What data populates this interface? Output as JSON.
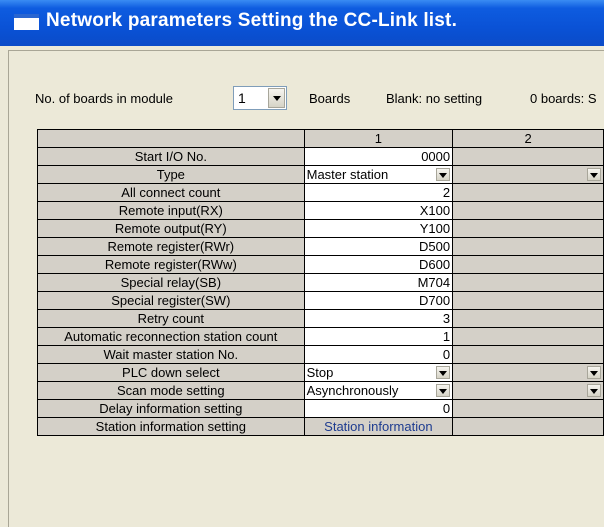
{
  "window": {
    "title": "Network parameters  Setting the CC-Link list."
  },
  "toolbar": {
    "boards_label": "No. of boards in module",
    "boards_value": "1",
    "boards_suffix": "Boards",
    "blank_note": "Blank: no setting",
    "zero_note": "0 boards: S"
  },
  "grid": {
    "columns": [
      "",
      "1",
      "2"
    ],
    "rows": [
      {
        "label": "Start I/O No.",
        "col1": "0000",
        "kind": "value"
      },
      {
        "label": "Type",
        "col1": "Master station",
        "kind": "select"
      },
      {
        "label": "All connect count",
        "col1": "2",
        "kind": "value"
      },
      {
        "label": "Remote input(RX)",
        "col1": "X100",
        "kind": "value"
      },
      {
        "label": "Remote output(RY)",
        "col1": "Y100",
        "kind": "value"
      },
      {
        "label": "Remote register(RWr)",
        "col1": "D500",
        "kind": "value"
      },
      {
        "label": "Remote register(RWw)",
        "col1": "D600",
        "kind": "value"
      },
      {
        "label": "Special relay(SB)",
        "col1": "M704",
        "kind": "value"
      },
      {
        "label": "Special register(SW)",
        "col1": "D700",
        "kind": "value"
      },
      {
        "label": "Retry count",
        "col1": "3",
        "kind": "value"
      },
      {
        "label": "Automatic reconnection station count",
        "col1": "1",
        "kind": "value"
      },
      {
        "label": "Wait master station No.",
        "col1": "0",
        "kind": "value"
      },
      {
        "label": "PLC down select",
        "col1": "Stop",
        "kind": "select"
      },
      {
        "label": "Scan mode setting",
        "col1": "Asynchronously",
        "kind": "select"
      },
      {
        "label": "Delay information setting",
        "col1": "0",
        "kind": "value"
      },
      {
        "label": "Station information setting",
        "col1": "Station information",
        "kind": "button"
      }
    ]
  }
}
